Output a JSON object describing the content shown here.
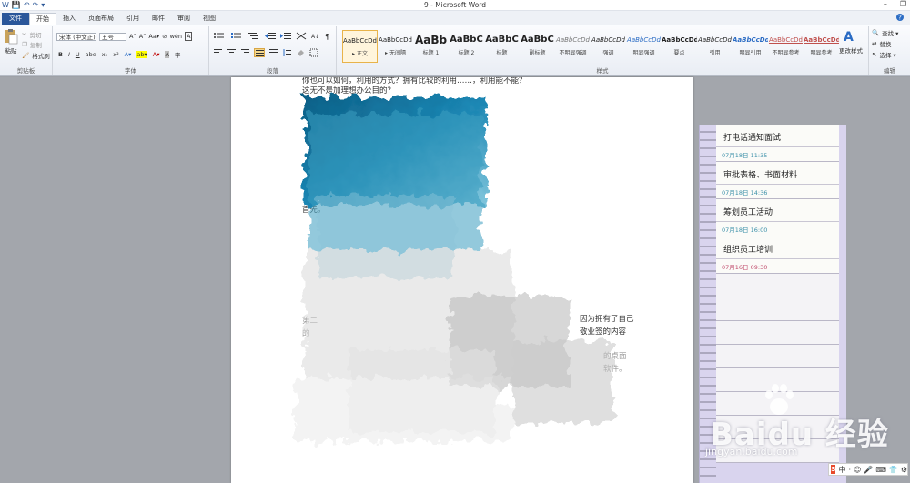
{
  "window": {
    "title": "9 - Microsoft Word",
    "min": "–",
    "restore": "❐"
  },
  "qat": [
    "W",
    "💾",
    "↶",
    "↷",
    "▾"
  ],
  "tabs": [
    {
      "label": "文件"
    },
    {
      "label": "开始"
    },
    {
      "label": "插入"
    },
    {
      "label": "页面布局"
    },
    {
      "label": "引用"
    },
    {
      "label": "邮件"
    },
    {
      "label": "审阅"
    },
    {
      "label": "视图"
    }
  ],
  "ribbon": {
    "clipboard": {
      "label": "剪贴板",
      "paste": "粘贴",
      "cut": "剪切",
      "copy": "复制",
      "format_painter": "格式刷"
    },
    "font": {
      "label": "字体",
      "font_name": "宋体 (中文正)",
      "font_size": "五号",
      "grow": "A˄",
      "shrink": "A˅",
      "change_case": "Aa▾",
      "clear": "⊘",
      "wen": "wén",
      "char_border": "A",
      "bold": "B",
      "italic": "I",
      "underline": "U",
      "strike": "abe",
      "sub": "x₂",
      "sup": "x²",
      "effects": "A▾",
      "highlight": "ab▾",
      "color": "A▾",
      "shade": "A",
      "circle": "字"
    },
    "paragraph": {
      "label": "段落"
    },
    "styles": {
      "label": "样式",
      "items": [
        {
          "sample": "AaBbCcDd",
          "name": "▸ 正文"
        },
        {
          "sample": "AaBbCcDd",
          "name": "▸ 无间隔"
        },
        {
          "sample": "AaBb",
          "name": "标题 1"
        },
        {
          "sample": "AaBbC",
          "name": "标题 2"
        },
        {
          "sample": "AaBbC",
          "name": "标题"
        },
        {
          "sample": "AaBbC",
          "name": "副标题"
        },
        {
          "sample": "AaBbCcDd",
          "name": "不明显强调"
        },
        {
          "sample": "AaBbCcDd",
          "name": "强调"
        },
        {
          "sample": "AaBbCcDd",
          "name": "明显强调"
        },
        {
          "sample": "AaBbCcDd",
          "name": "要点"
        },
        {
          "sample": "AaBbCcDd",
          "name": "引用"
        },
        {
          "sample": "AaBbCcDd",
          "name": "明显引用"
        },
        {
          "sample": "AaBbCcDd",
          "name": "不明显参考"
        },
        {
          "sample": "AaBbCcDd",
          "name": "明显参考"
        }
      ],
      "change_styles": "更改样式"
    },
    "editing": {
      "label": "编辑",
      "find": "查找 ▾",
      "replace": "替换",
      "select": "选择 ▾"
    }
  },
  "document": {
    "line1": "  你也可以如何，利用的方式？拥有比较的利用……，利用能不能？",
    "line2": "  这无不是加理想办公目的？",
    "line3": "首先，",
    "line4a": "第二",
    "line4b": "因为拥有了自己",
    "line5a": "的",
    "line5b": "敬业签的内容",
    "line6b": "的桌面",
    "line7b": "软件。"
  },
  "notes": [
    {
      "title": "打电话通知面试",
      "date": "07月18日 11:35",
      "color": "blue"
    },
    {
      "title": "审批表格、书面材料",
      "date": "07月18日 14:36",
      "color": "blue"
    },
    {
      "title": "筹划员工活动",
      "date": "07月18日 16:00",
      "color": "blue"
    },
    {
      "title": "组织员工培训",
      "date": "07月16日 09:30",
      "color": "red"
    }
  ],
  "watermark": {
    "main": "Baidu 经验",
    "sub": "jingyan.baidu.com"
  },
  "ime": {
    "logo": "S",
    "lang": "中",
    "items": [
      "·",
      "☺",
      "🎤",
      "⌨",
      "👕",
      "⚙"
    ]
  },
  "colors": {
    "file_tab": "#2b579a",
    "note_blue": "#3a8fa8",
    "note_red": "#c04a6b",
    "paint_blue": "#1a6f9c"
  }
}
